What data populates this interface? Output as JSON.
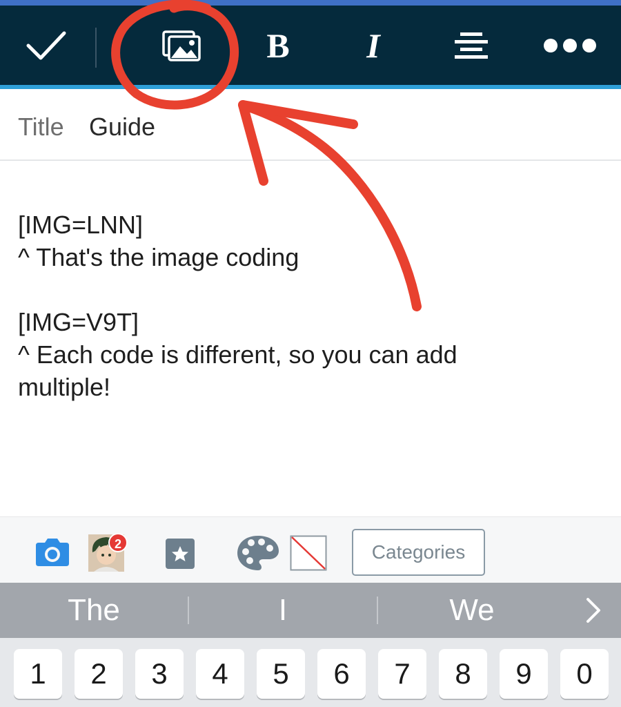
{
  "toolbar": {
    "buttons": [
      {
        "name": "confirm",
        "icon": "check-icon"
      },
      {
        "name": "insert-image",
        "icon": "image-icon"
      },
      {
        "name": "bold",
        "label": "B"
      },
      {
        "name": "italic",
        "label": "I"
      },
      {
        "name": "align",
        "icon": "align-center-icon"
      },
      {
        "name": "more",
        "icon": "more-horizontal-icon"
      }
    ],
    "background_color": "#052a3c",
    "accent_color": "#2e9fd8"
  },
  "post": {
    "title_label": "Title",
    "title_value": "Guide",
    "body_lines": [
      "[IMG=LNN]",
      "^ That's the image coding",
      "",
      "[IMG=V9T]",
      "^ Each code is different, so you can add",
      "multiple!"
    ]
  },
  "attach_bar": {
    "items": [
      {
        "name": "camera",
        "icon": "camera-icon",
        "color": "#2f8de4"
      },
      {
        "name": "avatar",
        "icon": "avatar-icon",
        "badge": "2"
      },
      {
        "name": "sticker",
        "icon": "star-sticker-icon"
      },
      {
        "name": "palette",
        "icon": "palette-icon"
      },
      {
        "name": "no-background",
        "icon": "no-background-icon"
      }
    ],
    "categories_label": "Categories"
  },
  "keyboard": {
    "suggestions": [
      "The",
      "I",
      "We"
    ],
    "more_icon": "chevron-right-icon",
    "number_keys": [
      "1",
      "2",
      "3",
      "4",
      "5",
      "6",
      "7",
      "8",
      "9",
      "0"
    ]
  },
  "annotation": {
    "description": "red-circle-and-arrow",
    "color": "#e8412f"
  }
}
